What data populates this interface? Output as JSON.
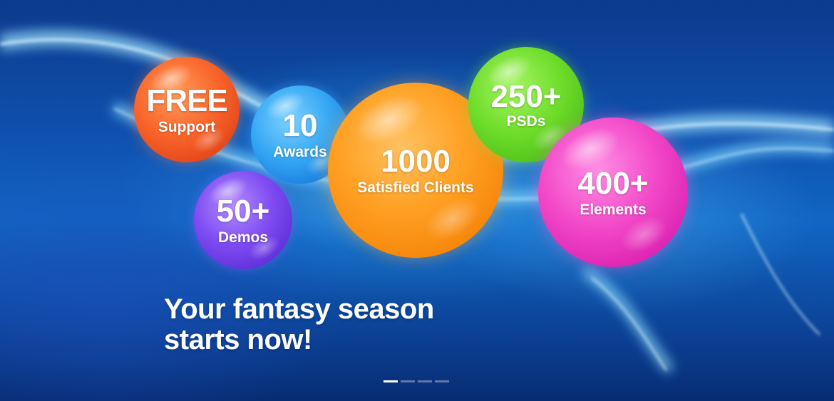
{
  "slider": {
    "bubbles": [
      {
        "big": "FREE",
        "small": "Support",
        "color": "#f9652a"
      },
      {
        "big": "10",
        "small": "Awards",
        "color": "#36a8f4"
      },
      {
        "big": "50+",
        "small": "Demos",
        "color": "#7f4cf2"
      },
      {
        "big": "1000",
        "small": "Satisfied Clients",
        "color": "#ffa226"
      },
      {
        "big": "250+",
        "small": "PSDs",
        "color": "#6fdd2a"
      },
      {
        "big": "400+",
        "small": "Elements",
        "color": "#f247c8"
      }
    ],
    "tagline": {
      "line1": "Your fantasy season",
      "line2": "starts now!"
    },
    "pager": {
      "total_slides": 4,
      "active_slide": 1
    },
    "colors": {
      "background_deep": "#0c3a8c",
      "background_mid": "#1166c4",
      "text": "#ffffff"
    }
  }
}
